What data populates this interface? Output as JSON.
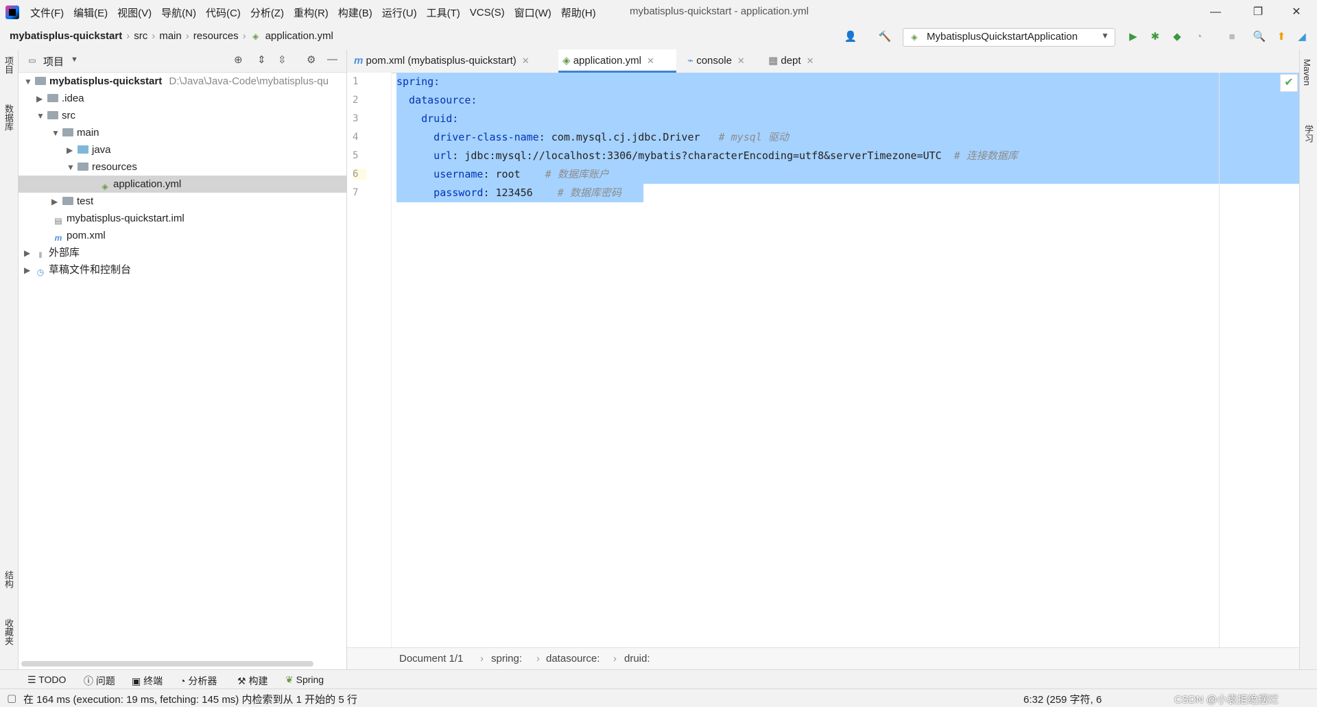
{
  "titlebar": {
    "menu": [
      "文件(F)",
      "编辑(E)",
      "视图(V)",
      "导航(N)",
      "代码(C)",
      "分析(Z)",
      "重构(R)",
      "构建(B)",
      "运行(U)",
      "工具(T)",
      "VCS(S)",
      "窗口(W)",
      "帮助(H)"
    ],
    "title": "mybatisplus-quickstart - application.yml",
    "min_icon": "—",
    "restore_icon": "❐",
    "close_icon": "✕"
  },
  "navbar": {
    "crumbs": [
      "mybatisplus-quickstart",
      "src",
      "main",
      "resources",
      "application.yml"
    ],
    "run_config": "MybatisplusQuickstartApplication"
  },
  "left_stripe": {
    "project": "项目",
    "database": "数据库",
    "structure": "结构",
    "favorites": "收藏夹"
  },
  "right_stripe": {
    "maven": "Maven",
    "learn": "学习"
  },
  "project_panel": {
    "title": "项目",
    "tree": [
      {
        "label": "mybatisplus-quickstart",
        "path": "D:\\Java\\Java-Code\\mybatisplus-qu"
      },
      {
        "label": ".idea"
      },
      {
        "label": "src"
      },
      {
        "label": "main"
      },
      {
        "label": "java"
      },
      {
        "label": "resources"
      },
      {
        "label": "application.yml"
      },
      {
        "label": "test"
      },
      {
        "label": "mybatisplus-quickstart.iml"
      },
      {
        "label": "pom.xml"
      },
      {
        "label": "外部库"
      },
      {
        "label": "草稿文件和控制台"
      }
    ]
  },
  "tabs": [
    {
      "label": "pom.xml (mybatisplus-quickstart)"
    },
    {
      "label": "application.yml"
    },
    {
      "label": "console"
    },
    {
      "label": "dept"
    }
  ],
  "editor": {
    "line_numbers": [
      "1",
      "2",
      "3",
      "4",
      "5",
      "6",
      "7"
    ],
    "lines": [
      {
        "key": "spring:",
        "value": "",
        "comment": ""
      },
      {
        "key": "  datasource:",
        "value": "",
        "comment": ""
      },
      {
        "key": "    druid:",
        "value": "",
        "comment": ""
      },
      {
        "key": "      driver-class-name",
        "value": ": com.mysql.cj.jdbc.Driver",
        "comment": "   # mysql 驱动"
      },
      {
        "key": "      url",
        "value": ": jdbc:mysql://localhost:3306/mybatis?characterEncoding=utf8&serverTimezone=UTC",
        "comment": "  # 连接数据库"
      },
      {
        "key": "      username",
        "value": ": root",
        "comment": "    # 数据库账户"
      },
      {
        "key": "      password",
        "value": ": 123456",
        "comment": "    # 数据库密码"
      }
    ],
    "breadcrumb": [
      "Document 1/1",
      "spring:",
      "datasource:",
      "druid:"
    ]
  },
  "bottom_tools": [
    "TODO",
    "问题",
    "终端",
    "分析器",
    "构建",
    "Spring"
  ],
  "status": {
    "message": "在 164 ms (execution: 19 ms, fetching: 145 ms) 内检索到从 1 开始的 5 行",
    "position": "6:32 (259 字符, 6",
    "watermark": "CSDN @小袁拒绝摆烂"
  },
  "colors": {
    "selection": "#a6d2ff",
    "key": "#0033b3",
    "accent": "#4083c9"
  }
}
